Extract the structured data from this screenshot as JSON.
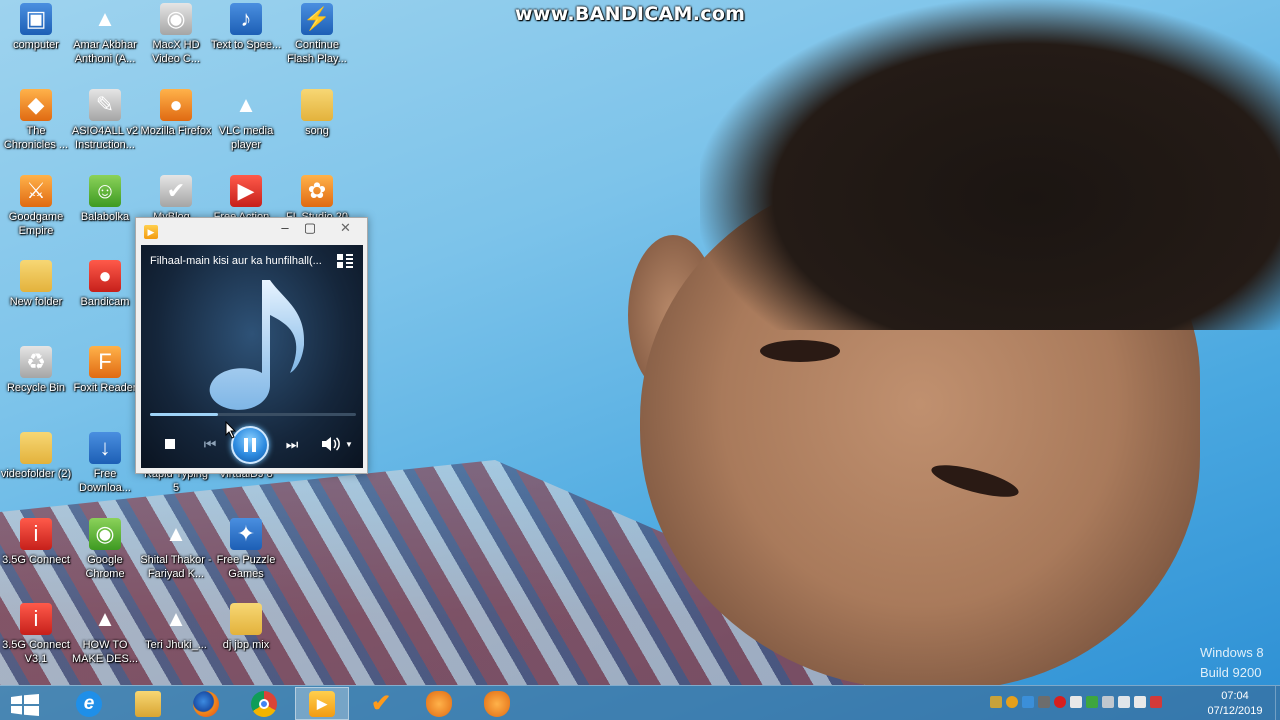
{
  "watermark": "www.BANDICAM.com",
  "os_watermark": {
    "line1": "Windows 8",
    "line2": "Build 9200"
  },
  "desktop_icons": [
    {
      "label": "computer",
      "icon": "computer-icon"
    },
    {
      "label": "Amar Akbhar Anthoni (A...",
      "icon": "vlc-icon"
    },
    {
      "label": "MacX HD Video C...",
      "icon": "film-reel-icon"
    },
    {
      "label": "Text to Spee...",
      "icon": "text-to-speech-icon"
    },
    {
      "label": "Continue Flash Play...",
      "icon": "flash-player-icon"
    },
    {
      "label": "The Chronicles ...",
      "icon": "movie-poster-icon"
    },
    {
      "label": "ASIO4ALL v2 Instruction...",
      "icon": "pdf-document-icon"
    },
    {
      "label": "Mozilla Firefox",
      "icon": "firefox-icon"
    },
    {
      "label": "VLC media player",
      "icon": "vlc-icon"
    },
    {
      "label": "song",
      "icon": "folder-icon"
    },
    {
      "label": "Goodgame Empire",
      "icon": "game-icon"
    },
    {
      "label": "Balabolka",
      "icon": "balabolka-icon"
    },
    {
      "label": "MyBlog...",
      "icon": "checklist-icon"
    },
    {
      "label": "Free Action...",
      "icon": "app-icon"
    },
    {
      "label": "FL Studio 20",
      "icon": "fl-studio-icon"
    },
    {
      "label": "New folder",
      "icon": "folder-icon"
    },
    {
      "label": "Bandicam",
      "icon": "bandicam-icon"
    },
    {
      "label": "Recycle Bin",
      "icon": "recycle-bin-icon"
    },
    {
      "label": "Foxit Reader",
      "icon": "foxit-icon"
    },
    {
      "label": "videofolder (2)",
      "icon": "folder-icon"
    },
    {
      "label": "Free Downloa...",
      "icon": "download-icon"
    },
    {
      "label": "Rapid Typing 5",
      "icon": "typing-icon"
    },
    {
      "label": "VirtualDJ 8",
      "icon": "dj-icon"
    },
    {
      "label": "3.5G Connect",
      "icon": "modem-icon"
    },
    {
      "label": "Google Chrome",
      "icon": "chrome-icon"
    },
    {
      "label": "Shital Thakor - Fariyad K...",
      "icon": "vlc-icon"
    },
    {
      "label": "Free Puzzle Games",
      "icon": "puzzle-icon"
    },
    {
      "label": "3.5G Connect V3.1",
      "icon": "modem-icon"
    },
    {
      "label": "HOW TO MAKE DES...",
      "icon": "vlc-icon"
    },
    {
      "label": "Teri Jhuki_...",
      "icon": "vlc-icon"
    },
    {
      "label": "dj jbp mix",
      "icon": "folder-icon"
    }
  ],
  "player": {
    "now_playing": "Filhaal-main kisi aur ka hunfilhall(...",
    "progress": 0.33
  },
  "taskbar": {
    "apps": [
      "start-icon",
      "internet-explorer-icon",
      "file-explorer-icon",
      "firefox-icon",
      "chrome-icon",
      "media-player-icon",
      "checklist-icon",
      "fl-studio-icon",
      "fl-studio-icon"
    ],
    "clock_time": "07:04",
    "clock_date": "07/12/2019"
  }
}
